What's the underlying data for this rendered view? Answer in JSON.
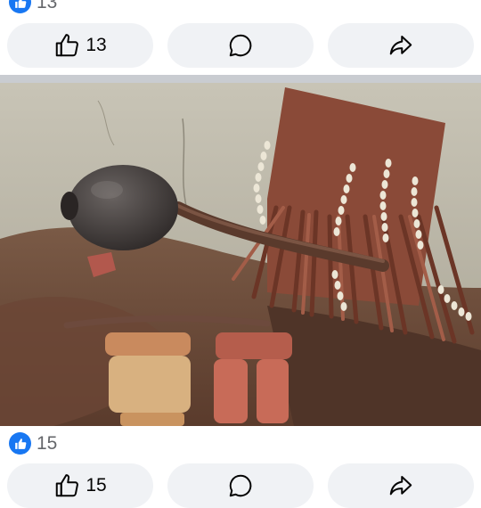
{
  "colors": {
    "facebook_blue": "#1877f2",
    "button_bg": "#f0f2f5",
    "separator": "#c9ccd1"
  },
  "previous_post": {
    "like_icon": "thumbs-up-badge-icon",
    "reaction_count": "13",
    "actions": {
      "like_icon": "thumbs-up-icon",
      "like_count": "13",
      "comment_icon": "comment-bubble-icon",
      "share_icon": "share-arrow-icon"
    }
  },
  "post": {
    "photo_subject": "gourd-pipe-beaded-fringe-leather-bag-and-two-wooden-stools",
    "like_icon": "thumbs-up-badge-icon",
    "reaction_count": "15",
    "actions": {
      "like_icon": "thumbs-up-icon",
      "like_count": "15",
      "comment_icon": "comment-bubble-icon",
      "share_icon": "share-arrow-icon"
    }
  }
}
